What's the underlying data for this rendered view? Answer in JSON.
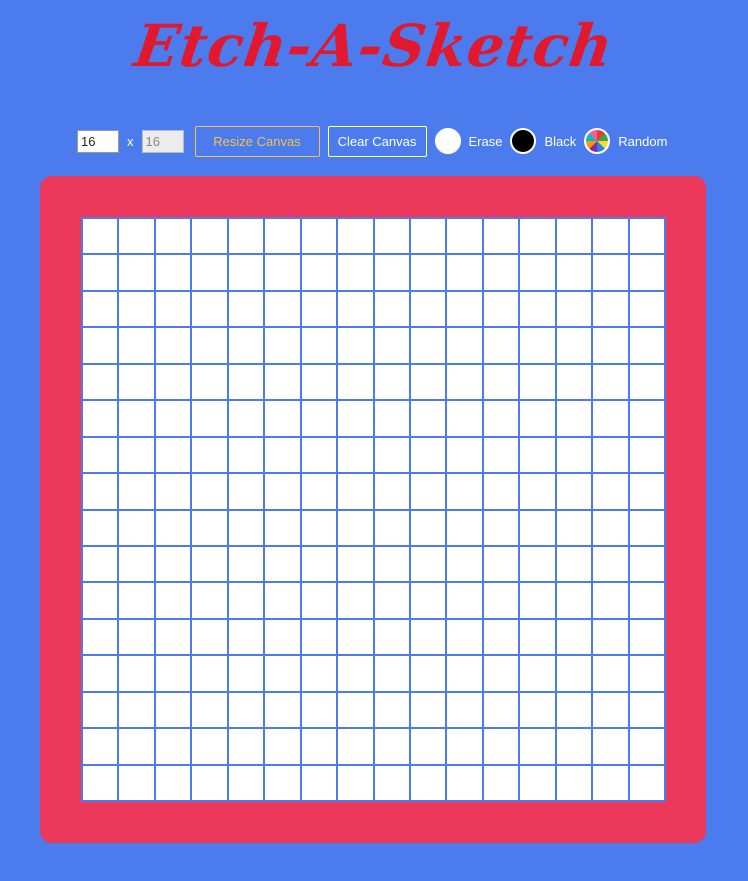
{
  "title": "Etch-A-Sketch",
  "controls": {
    "width_value": "16",
    "height_value": "16",
    "x_label": "x",
    "resize_label": "Resize Canvas",
    "clear_label": "Clear Canvas",
    "modes": [
      {
        "label": "Erase",
        "color": "#ffffff"
      },
      {
        "label": "Black",
        "color": "#000000"
      },
      {
        "label": "Random",
        "color": "multicolor"
      }
    ]
  },
  "grid": {
    "rows": 16,
    "cols": 16,
    "cell_color": "#ffffff"
  },
  "colors": {
    "background": "#4b7bec",
    "title": "#e0192e",
    "frame": "#ec385b",
    "resize_button": "#f3c24a",
    "grid_line": "#4b7bec"
  }
}
